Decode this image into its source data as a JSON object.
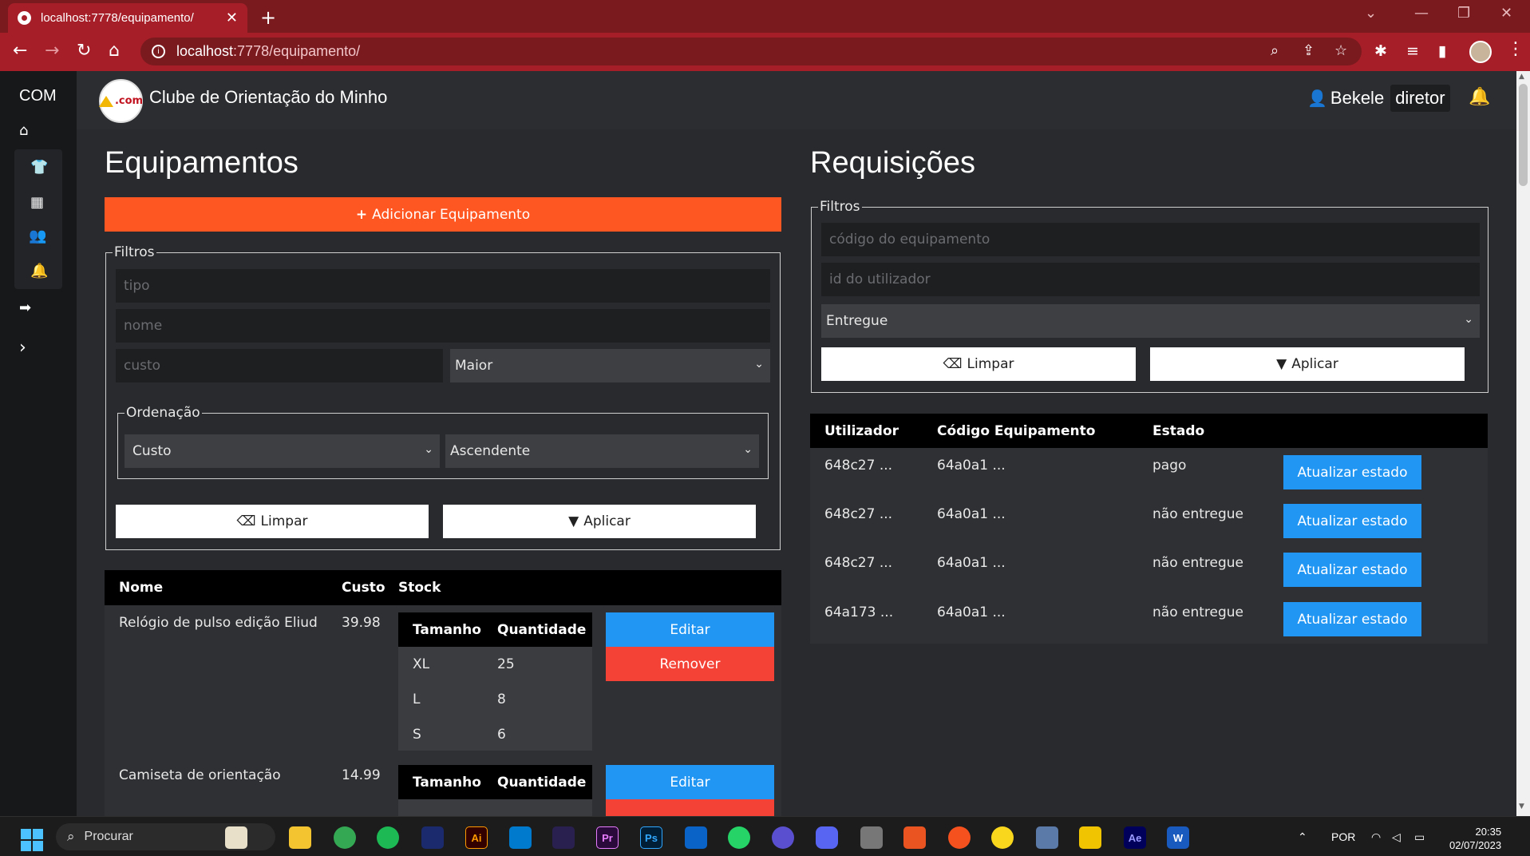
{
  "browser": {
    "tab_title": "localhost:7778/equipamento/",
    "url_host": "localhost",
    "url_rest": ":7778/equipamento/"
  },
  "app": {
    "brand": "COM",
    "club_name": "Clube de Orientação do Minho",
    "logo_text": ".com",
    "user_name": "Bekele",
    "user_role": "diretor"
  },
  "equipamentos": {
    "title": "Equipamentos",
    "add_button": "Adicionar Equipamento",
    "filters_legend": "Filtros",
    "tipo_placeholder": "tipo",
    "nome_placeholder": "nome",
    "custo_placeholder": "custo",
    "comparator": "Maior",
    "ordering_legend": "Ordenação",
    "order_field": "Custo",
    "order_direction": "Ascendente",
    "clear_button": "Limpar",
    "apply_button": "Aplicar",
    "columns": [
      "Nome",
      "Custo",
      "Stock"
    ],
    "stock_columns": [
      "Tamanho",
      "Quantidade"
    ],
    "items": [
      {
        "name": "Relógio de pulso edição Eliud",
        "cost": "39.98",
        "stock": [
          {
            "size": "XL",
            "qty": "25"
          },
          {
            "size": "L",
            "qty": "8"
          },
          {
            "size": "S",
            "qty": "6"
          }
        ]
      },
      {
        "name": "Camiseta de orientação",
        "cost": "14.99",
        "stock": []
      }
    ],
    "edit_button": "Editar",
    "remove_button": "Remover"
  },
  "requisicoes": {
    "title": "Requisições",
    "filters_legend": "Filtros",
    "code_placeholder": "código do equipamento",
    "user_placeholder": "id do utilizador",
    "state_filter": "Entregue",
    "clear_button": "Limpar",
    "apply_button": "Aplicar",
    "columns": [
      "Utilizador",
      "Código Equipamento",
      "Estado"
    ],
    "rows": [
      {
        "user": "648c27 ...",
        "code": "64a0a1 ...",
        "state": "pago"
      },
      {
        "user": "648c27 ...",
        "code": "64a0a1 ...",
        "state": "não entregue"
      },
      {
        "user": "648c27 ...",
        "code": "64a0a1 ...",
        "state": "não entregue"
      },
      {
        "user": "64a173 ...",
        "code": "64a0a1 ...",
        "state": "não entregue"
      }
    ],
    "update_button": "Atualizar estado"
  },
  "taskbar": {
    "search_label": "Procurar",
    "language": "POR",
    "time": "20:35",
    "date": "02/07/2023"
  },
  "colors": {
    "accent_orange": "#ff5722",
    "button_blue": "#2196f3",
    "button_red": "#f44336",
    "browser_red": "#a61e28"
  }
}
